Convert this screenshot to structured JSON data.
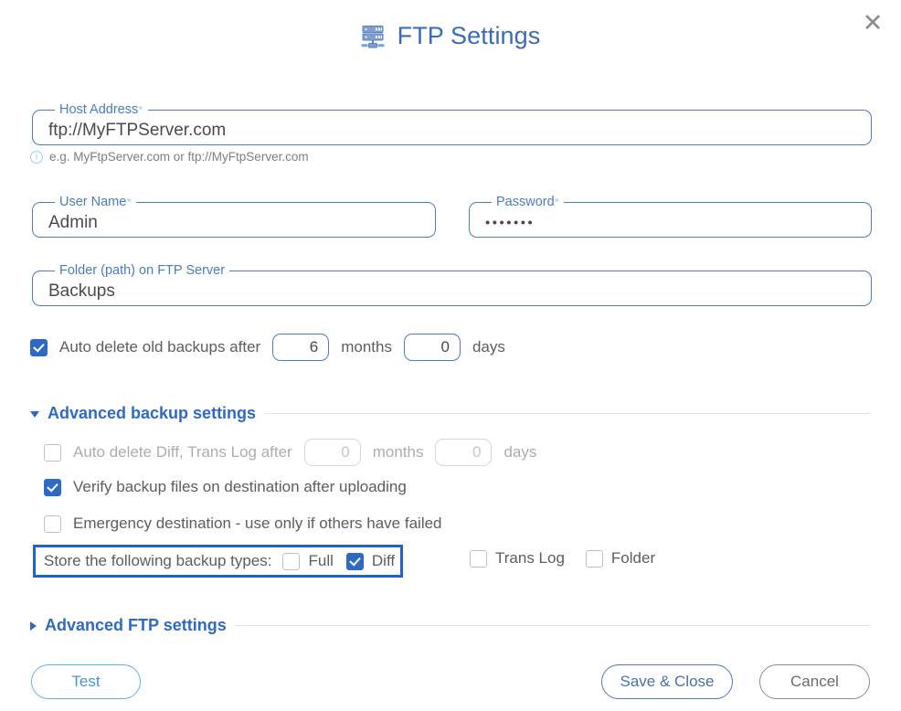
{
  "window": {
    "title": "FTP Settings",
    "title_icon": "server-network-icon",
    "close_label": "✕",
    "accent_blue": "#2e6ac4",
    "title_blue": "#3a6bb5",
    "border_blue": "#4a7cc0"
  },
  "fields": {
    "host": {
      "label": "Host Address",
      "required_mark": "*",
      "value": "ftp://MyFTPServer.com",
      "hint": "e.g. MyFtpServer.com or ftp://MyFtpServer.com",
      "hint_icon": "info-icon",
      "hint_icon_glyph": "i"
    },
    "user": {
      "label": "User Name",
      "required_mark": "*",
      "value": "Admin"
    },
    "password": {
      "label": "Password",
      "required_mark": "*",
      "value": "•••••••"
    },
    "folder": {
      "label": "Folder (path) on FTP Server",
      "value": "Backups"
    }
  },
  "auto_delete": {
    "checked": true,
    "label": "Auto delete old backups after",
    "months_value": "6",
    "months_unit": "months",
    "days_value": "0",
    "days_unit": "days"
  },
  "advanced_backup": {
    "title": "Advanced backup settings",
    "expanded": true,
    "caret": "caret-down-icon",
    "auto_delete_diff": {
      "checked": false,
      "enabled": false,
      "label": "Auto delete Diff, Trans Log after",
      "months_value": "0",
      "months_unit": "months",
      "days_value": "0",
      "days_unit": "days"
    },
    "verify": {
      "checked": true,
      "label": "Verify backup files on destination after uploading"
    },
    "emergency": {
      "checked": false,
      "label": "Emergency destination - use only if others have failed"
    },
    "backup_types": {
      "label": "Store the following backup types:",
      "focused": true,
      "options": [
        {
          "label": "Full",
          "checked": false
        },
        {
          "label": "Diff",
          "checked": true
        },
        {
          "label": "Trans Log",
          "checked": false
        },
        {
          "label": "Folder",
          "checked": false
        }
      ]
    }
  },
  "advanced_ftp": {
    "title": "Advanced FTP settings",
    "expanded": false,
    "caret": "caret-right-icon"
  },
  "buttons": {
    "test": "Test",
    "save": "Save & Close",
    "cancel": "Cancel"
  }
}
